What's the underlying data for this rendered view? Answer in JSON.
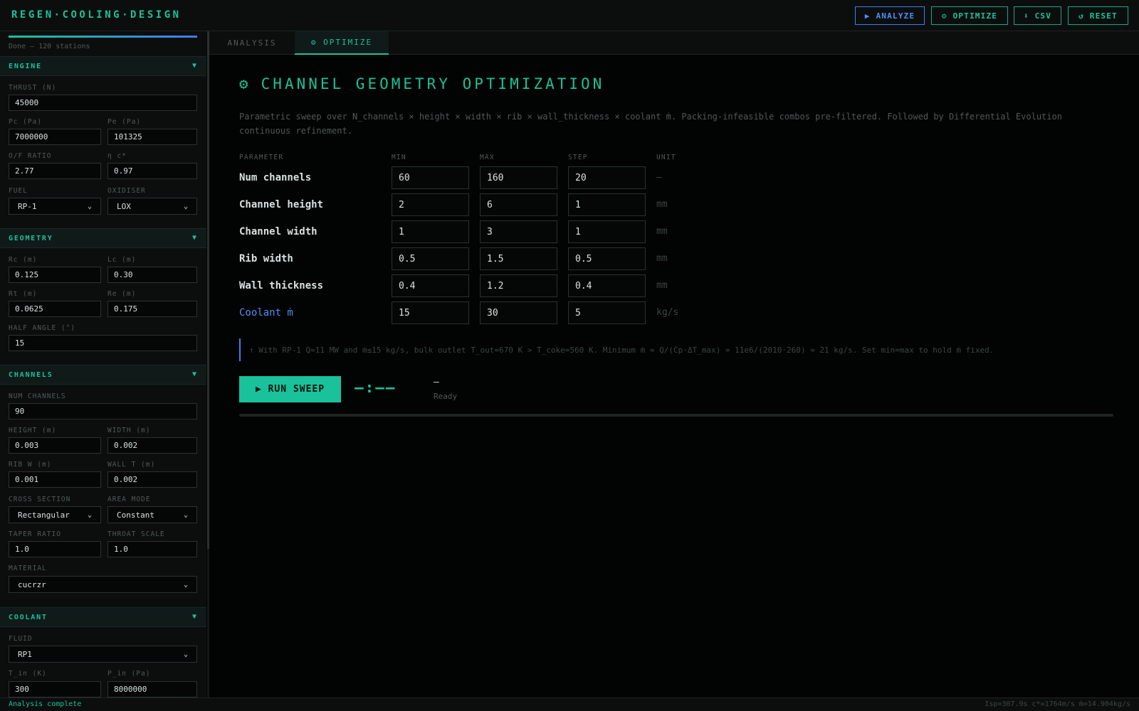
{
  "app": {
    "title": "REGEN·COOLING·DESIGN"
  },
  "header_buttons": {
    "analyze": "▶ ANALYZE",
    "optimize": "⚙ OPTIMIZE",
    "csv": "⬇ CSV",
    "reset": "↺ RESET"
  },
  "sidebar": {
    "progress": {
      "fraction": 1.0,
      "text": "Done — 120 stations"
    },
    "engine": {
      "title": "ENGINE",
      "thrust_label": "THRUST (N)",
      "thrust": "45000",
      "pc_label": "Pc (Pa)",
      "pc": "7000000",
      "pe_label": "Pe (Pa)",
      "pe": "101325",
      "of_label": "O/F RATIO",
      "of": "2.77",
      "eta_label": "η c*",
      "eta": "0.97",
      "fuel_label": "FUEL",
      "fuel": "RP-1",
      "ox_label": "OXIDISER",
      "ox": "LOX"
    },
    "geometry": {
      "title": "GEOMETRY",
      "rc_label": "Rc (m)",
      "rc": "0.125",
      "lc_label": "Lc (m)",
      "lc": "0.30",
      "rt_label": "Rt (m)",
      "rt": "0.0625",
      "re_label": "Re (m)",
      "re": "0.175",
      "half_label": "HALF ANGLE (°)",
      "half": "15"
    },
    "channels": {
      "title": "CHANNELS",
      "num_label": "NUM CHANNELS",
      "num": "90",
      "height_label": "HEIGHT (m)",
      "height": "0.003",
      "width_label": "WIDTH (m)",
      "width": "0.002",
      "rib_label": "RIB W (m)",
      "rib": "0.001",
      "wall_label": "WALL T (m)",
      "wall": "0.002",
      "cross_label": "CROSS SECTION",
      "cross": "Rectangular",
      "area_label": "AREA MODE",
      "area": "Constant",
      "taper_label": "TAPER RATIO",
      "taper": "1.0",
      "throat_label": "THROAT SCALE",
      "throat": "1.0",
      "material_label": "MATERIAL",
      "material": "cucrzr"
    },
    "coolant": {
      "title": "COOLANT",
      "fluid_label": "FLUID",
      "fluid": "RP1",
      "tin_label": "T_in (K)",
      "tin": "300",
      "pin_label": "P_in (Pa)",
      "pin": "8000000"
    },
    "chevron": "▼"
  },
  "tabs": [
    {
      "label": "ANALYSIS"
    },
    {
      "label": "⚙ OPTIMIZE"
    }
  ],
  "main": {
    "title": "CHANNEL GEOMETRY OPTIMIZATION",
    "title_icon": "⚙",
    "description": "Parametric sweep over N_channels × height × width × rib × wall_thickness × coolant ṁ. Packing-infeasible combos pre-filtered. Followed by Differential Evolution continuous refinement.",
    "columns": [
      "PARAMETER",
      "MIN",
      "MAX",
      "STEP",
      "UNIT"
    ],
    "params": [
      {
        "name": "Num channels",
        "min": "60",
        "max": "160",
        "step": "20",
        "unit": "—"
      },
      {
        "name": "Channel height",
        "min": "2",
        "max": "6",
        "step": "1",
        "unit": "mm"
      },
      {
        "name": "Channel width",
        "min": "1",
        "max": "3",
        "step": "1",
        "unit": "mm"
      },
      {
        "name": "Rib width",
        "min": "0.5",
        "max": "1.5",
        "step": "0.5",
        "unit": "mm"
      },
      {
        "name": "Wall thickness",
        "min": "0.4",
        "max": "1.2",
        "step": "0.4",
        "unit": "mm"
      },
      {
        "name": "Coolant ṁ",
        "min": "15",
        "max": "30",
        "step": "5",
        "unit": "kg/s"
      }
    ],
    "note": "↑ With RP-1 Q≈11 MW and ṁ≤15 kg/s, bulk outlet T_out≈670 K > T_coke=560 K. Minimum ṁ ≈ Q/(Cp·ΔT_max) = 11e6/(2010·260) ≈ 21 kg/s. Set min=max to hold ṁ fixed.",
    "run_label": "▶ RUN SWEEP",
    "timer": "—:——",
    "run_dash": "—",
    "run_status": "Ready",
    "sweep_progress": 0
  },
  "status": {
    "left": "Analysis complete",
    "right": "Isp=307.9s c*=1764m/s ṁ=14.904kg/s"
  },
  "colors": {
    "accent": "#19c29a",
    "blue": "#4f8ef7",
    "bg": "#020303"
  }
}
